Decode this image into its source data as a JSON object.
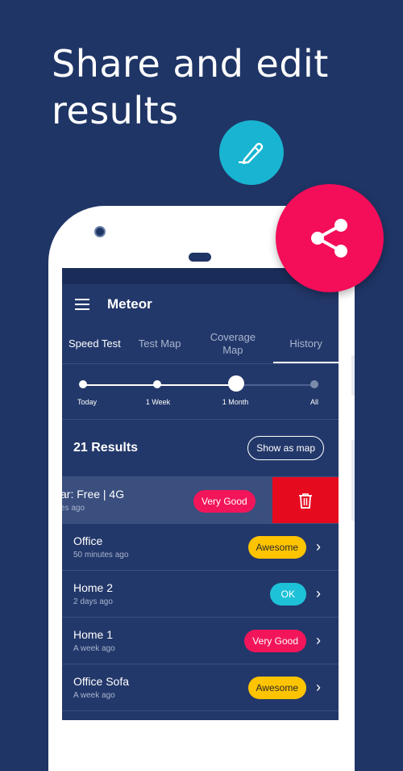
{
  "headline": "Share and edit results",
  "app": {
    "title": "Meteor"
  },
  "tabs": [
    {
      "label": "Speed Test"
    },
    {
      "label": "Test Map"
    },
    {
      "label": "Coverage Map"
    },
    {
      "label": "History"
    }
  ],
  "timeline": {
    "stops": [
      "Today",
      "1 Week",
      "1 Month",
      "All"
    ],
    "selected": "1 Month"
  },
  "results": {
    "count": "21 Results",
    "map_button": "Show as map"
  },
  "swiped_row": {
    "title": "ar: Free | 4G",
    "time": "es ago",
    "badge": "Very Good"
  },
  "rows": [
    {
      "title": "Office",
      "time": "50 minutes ago",
      "badge": "Awesome"
    },
    {
      "title": "Home 2",
      "time": "2 days ago",
      "badge": "OK"
    },
    {
      "title": "Home 1",
      "time": "A week ago",
      "badge": "Very Good"
    },
    {
      "title": "Office Sofa",
      "time": "A week ago",
      "badge": "Awesome"
    }
  ],
  "colors": {
    "background": "#1f3566",
    "awesome": "#ffc400",
    "ok": "#1ec2d8",
    "very_good": "#f2155a",
    "delete": "#e60a1f",
    "edit_fab": "#19b4d2",
    "share_fab": "#f40d58"
  },
  "icons": {
    "edit": "pencil-icon",
    "share": "share-icon",
    "delete": "trash-icon",
    "menu": "menu-icon",
    "chevron": "chevron-right-icon"
  }
}
